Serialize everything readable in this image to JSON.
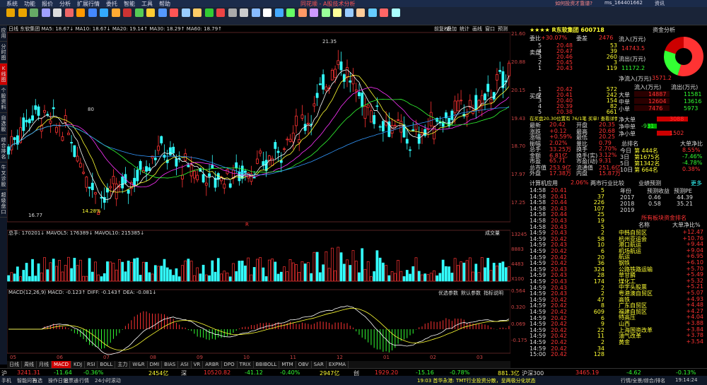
{
  "menubar": {
    "items": [
      "系统",
      "功能",
      "报价",
      "分析",
      "扩展行情",
      "委托",
      "智能",
      "工具",
      "帮助"
    ],
    "brand": "同花顺 - A股技术分析",
    "right": [
      "如何投资才靠谱?",
      "ms_164401662",
      "资讯"
    ]
  },
  "toolbar": {
    "buttons": [
      "",
      "",
      "",
      "",
      "",
      "",
      "",
      "",
      "",
      "分时",
      "K线",
      "",
      "自选",
      "",
      "",
      "",
      "",
      "",
      "",
      "",
      "周期",
      "F10/F9",
      "画线",
      "",
      "",
      "资讯",
      "F10",
      "",
      "",
      "",
      "",
      "",
      "",
      "",
      "",
      "",
      "竞价",
      "分析",
      "会谈",
      "",
      "个股",
      "研报",
      "资金",
      "",
      "",
      "",
      "",
      "",
      "",
      "",
      "",
      "",
      "",
      "",
      "新股",
      "全景",
      "综合排名",
      "",
      "",
      "",
      "",
      "",
      "",
      "",
      "",
      "",
      "",
      "",
      "全景",
      "分析",
      "多窗口",
      "",
      "",
      "论股",
      "",
      "",
      "",
      "",
      "",
      "",
      "",
      "",
      ""
    ],
    "labels": [
      "",
      "",
      "",
      "",
      "",
      "",
      "",
      "",
      "",
      "",
      "",
      "分时",
      "K线",
      "",
      "",
      "自选",
      "",
      "",
      "",
      "",
      "",
      "",
      "",
      "周期",
      "F10/F9",
      "画线",
      "",
      "",
      "资讯",
      "",
      "",
      "",
      "",
      "",
      "",
      "",
      "个股",
      "研报",
      "资金",
      "",
      "",
      "分析",
      "多窗口",
      "",
      "",
      "论股"
    ]
  },
  "toolbar_labels": [
    "",
    "",
    "",
    "",
    "",
    "",
    "",
    "",
    "",
    "",
    "",
    "",
    "",
    "",
    "",
    "",
    "",
    "",
    "",
    "",
    "",
    "",
    "",
    "",
    "",
    "",
    "",
    "",
    "",
    "",
    "",
    ""
  ],
  "tb": [
    "",
    "",
    "",
    "",
    "",
    "",
    "",
    "",
    "",
    "",
    "",
    "",
    "",
    "",
    "",
    "",
    "",
    "",
    "",
    "",
    "",
    "",
    "",
    "",
    "",
    "",
    "",
    "",
    "",
    "",
    "",
    ""
  ],
  "left_tabs": [
    "应用",
    "分时图",
    "K线图",
    "个股资料",
    "自选股",
    "综合排名",
    "牛叉诊股",
    "超级盘口"
  ],
  "chart": {
    "header": "日线 东软集团 MA5: 18.67↓ MA10: 18.67↓ MA20: 19.14↑ MA30: 18.29↑ MA60: 18.79↑",
    "tools": [
      "前复权",
      "叠加",
      "统计",
      "画线",
      "窗口",
      "预测"
    ],
    "high_label": "21.35",
    "low_label": "16.77",
    "mid_label": "80",
    "pct_label": "14.28%",
    "vol_header": "总手: 170201↓  MAVOL5: 176389↓  MAVOL10: 215385↓",
    "vol_tab": "成交量",
    "macd_header": "MACD(12,26,9) MACD: -0.123↑ DIFF: -0.143↑ DEA: -0.081↓",
    "macd_tabs": [
      "优选参数",
      "默认参数",
      "指标说明"
    ],
    "price_axis": [
      "21.60",
      "20.88",
      "20.15",
      "19.43",
      "18.70",
      "17.97",
      "17.25"
    ],
    "vol_axis": [
      "13245",
      "8883",
      "4483",
      "X100"
    ],
    "macd_axis": [
      "0.564",
      "0.320",
      "0.069",
      "-0.175"
    ],
    "x_axis": [
      "05",
      "06",
      "07",
      "08",
      "09",
      "10",
      "11",
      "12",
      "01",
      "02",
      "03"
    ],
    "red_line": "R"
  },
  "bottom_tabs": [
    "日线",
    "周线",
    "月线",
    "MACD",
    "KDJ",
    "RSI",
    "BOLL",
    "主力",
    "W&R",
    "DMI",
    "BIAS",
    "ASI",
    "VR",
    "ARBR",
    "DPO",
    "TRIX",
    "BBIBOLL",
    "MTM",
    "OBV",
    "SAR",
    "EXPMA"
  ],
  "right": {
    "title": "资金分析",
    "stock_title": "★★★★ R东软集团 600718",
    "wei_bi": "委比",
    "wei_bi_val": "+30.07%",
    "wei_cha": "委差",
    "wei_cha_val": "2476",
    "sells": [
      [
        "5",
        "20.48",
        "53"
      ],
      [
        "4",
        "20.47",
        "39"
      ],
      [
        "3",
        "20.46",
        "260"
      ],
      [
        "2",
        "20.45",
        "3"
      ],
      [
        "1",
        "20.43",
        "119"
      ]
    ],
    "buys": [
      [
        "1",
        "20.42",
        "572"
      ],
      [
        "2",
        "20.41",
        "242"
      ],
      [
        "3",
        "20.40",
        "154"
      ],
      [
        "4",
        "20.39",
        "82"
      ],
      [
        "5",
        "20.38",
        "661"
      ]
    ],
    "sell_label": "卖盘",
    "buy_label": "买盘",
    "flow_in": "流入(万元)",
    "flow_in_val": "14743.5",
    "flow_out": "流出(万元)",
    "flow_out_val": "11172.2",
    "net_in": "净流入(万元)",
    "net_in_val": "3571.2",
    "flow_table": {
      "headers": [
        "流入(万元)",
        "流出(万元)"
      ],
      "rows": [
        [
          "大单",
          "14887",
          "11581"
        ],
        [
          "中单",
          "12604",
          "13616"
        ],
        [
          "小单",
          "7476",
          "5973"
        ]
      ]
    },
    "ring": "100",
    "ring_rows": [
      "净大单",
      "净中单",
      "净小单"
    ],
    "ring_vals": [
      "3088",
      "-931",
      "1502"
    ],
    "inst": "在买盘20.30位置有 76/1笔 买单! 查看详情",
    "quote": [
      [
        "最新",
        "20.42",
        "开盘",
        "20.35"
      ],
      [
        "涨跌",
        "+0.12",
        "最高",
        "20.68"
      ],
      [
        "涨幅",
        "+0.59%",
        "最低",
        "20.25"
      ],
      [
        "振幅",
        "2.02%",
        "量比",
        "0.79"
      ],
      [
        "总手",
        "33.25万",
        "换手",
        "2.70%"
      ],
      [
        "金额",
        "6.81亿",
        "换手(实)",
        "3.12%"
      ],
      [
        "市盈",
        "65.71",
        "市盈(动)",
        "9.31"
      ],
      [
        "总市值",
        "253.9亿",
        "流通值",
        "251.6亿"
      ],
      [
        "外盘",
        "17.38万",
        "内盘",
        "15.87万"
      ]
    ],
    "rank_title": "总排名",
    "rank_head": "大单净比",
    "ranks": [
      [
        "今日",
        "第 444名",
        "8.55%"
      ],
      [
        "3日",
        "第1675名",
        "-7.46%"
      ],
      [
        "5日",
        "第1342名",
        "-4.78%"
      ],
      [
        "10日",
        "第 664名",
        "0.38%"
      ]
    ],
    "ticks_head": "计算机应用",
    "ticks_pct": "2.06%",
    "ticks_other": "两市行业比较",
    "ticks": [
      [
        "14:58",
        "20.41",
        "5"
      ],
      [
        "14:58",
        "20.41",
        "37"
      ],
      [
        "14:58",
        "20.44",
        "226"
      ],
      [
        "14:58",
        "20.43",
        "107"
      ],
      [
        "14:58",
        "20.44",
        "25"
      ],
      [
        "14:58",
        "20.43",
        "19"
      ],
      [
        "14:58",
        "20.43",
        "5"
      ],
      [
        "14:59",
        "20.43",
        "2"
      ],
      [
        "14:59",
        "20.42",
        "58"
      ],
      [
        "14:59",
        "20.43",
        "10"
      ],
      [
        "14:59",
        "20.42",
        "6"
      ],
      [
        "14:59",
        "20.42",
        "20"
      ],
      [
        "14:59",
        "20.42",
        "36"
      ],
      [
        "14:59",
        "20.43",
        "324"
      ],
      [
        "14:59",
        "20.43",
        "28"
      ],
      [
        "14:59",
        "20.43",
        "174"
      ],
      [
        "14:59",
        "20.43",
        "2"
      ],
      [
        "14:59",
        "20.43",
        "2"
      ],
      [
        "14:59",
        "20.42",
        "47"
      ],
      [
        "14:59",
        "20.42",
        "8"
      ],
      [
        "14:59",
        "20.42",
        "609"
      ],
      [
        "14:59",
        "20.42",
        "6"
      ],
      [
        "14:59",
        "20.42",
        "9"
      ],
      [
        "14:59",
        "20.42",
        "22"
      ],
      [
        "14:59",
        "20.42",
        "11"
      ],
      [
        "14:59",
        "20.42",
        "2"
      ],
      [
        "14:59",
        "20.42",
        "34"
      ],
      [
        "15:00",
        "20.42",
        "128"
      ]
    ],
    "forecast_title": "业绩预测",
    "forecast_more": "更多",
    "forecast_head": [
      "年份",
      "预测收益",
      "预测PE"
    ],
    "forecast": [
      [
        "2017",
        "0.46",
        "44.39"
      ],
      [
        "2018",
        "0.58",
        "35.21"
      ],
      [
        "2019",
        "",
        ""
      ]
    ],
    "sector_title": "所有板块资金排名",
    "sector_head": [
      "名称",
      "大单净比%"
    ],
    "sectors": [
      [
        "中韩自贸区",
        "+12.47"
      ],
      [
        "杭州亚运会",
        "+10.76"
      ],
      [
        "港口航运",
        "+9.44"
      ],
      [
        "机场航运",
        "+9.04"
      ],
      [
        "航运",
        "+6.95"
      ],
      [
        "钢铁",
        "+6.10"
      ],
      [
        "公路铁路运输",
        "+5.70"
      ],
      [
        "草甘膦",
        "+5.49"
      ],
      [
        "煤化工",
        "+5.32"
      ],
      [
        "中字头股票",
        "+5.21"
      ],
      [
        "粤港澳自贸区",
        "+5.07"
      ],
      [
        "高铁",
        "+4.93"
      ],
      [
        "广东自贸区",
        "+4.48"
      ],
      [
        "福建自贸区",
        "+4.27"
      ],
      [
        "特高压",
        "+4.04"
      ],
      [
        "山西",
        "+3.88"
      ],
      [
        "上海国资改革",
        "+3.84"
      ],
      [
        "油气改革",
        "+3.78"
      ],
      [
        "黄金",
        "+3.54"
      ]
    ]
  },
  "status": {
    "sh": "沪",
    "sh_idx": "3241.31",
    "sh_chg": "-11.64",
    "sh_pct": "-0.36%",
    "sh_amt": "2454亿",
    "sz": "深",
    "sz_idx": "10520.82",
    "sz_chg": "-41.12",
    "sz_pct": "-0.40%",
    "sz_amt": "2947亿",
    "cy": "创",
    "cy_idx": "1929.20",
    "cy_chg": "-15.16",
    "cy_pct": "-0.78%",
    "hs": "沪深300",
    "hs_amt": "881.3亿",
    "hs_idx": "3465.19",
    "hs_chg": "-4.62",
    "hs_pct": "-0.13%"
  },
  "footer": {
    "left": [
      "手机",
      "智能问答",
      "自选",
      "操作日记",
      "股票通",
      "行情",
      "24小时滚动"
    ],
    "news": "19:03 首华永港: TMT行业投资分散，呈两极分化状态",
    "right": "行情/全景/综合/排名",
    "time": "19:14:24"
  },
  "colors": {
    "up": "#ff3333",
    "down": "#33ffff",
    "bg": "#000000",
    "grid": "#552222"
  }
}
